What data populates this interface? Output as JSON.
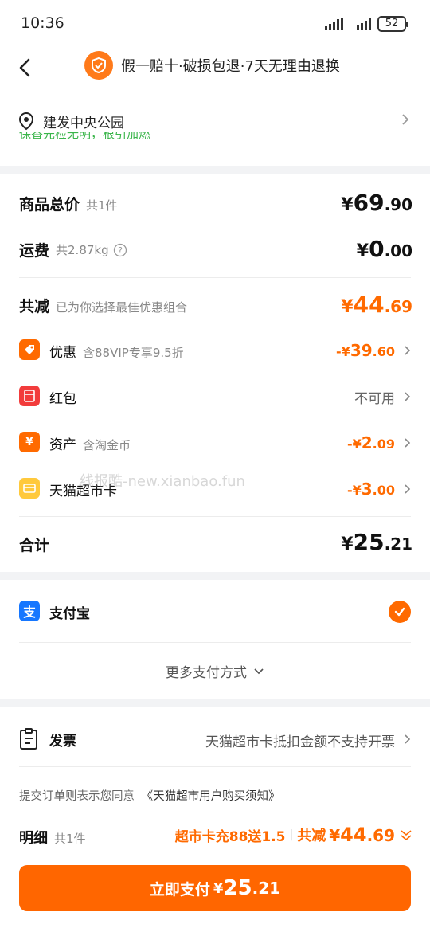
{
  "status_bar": {
    "time": "10:36",
    "battery": "52"
  },
  "header": {
    "guarantee_text": "假一赔十·破损包退·7天无理由退换"
  },
  "address": {
    "name": "建发中央公园",
    "cut_notice": "保香先检无明，根引加燃"
  },
  "price": {
    "goods_total": {
      "label": "商品总价",
      "sub": "共1件",
      "currency": "¥",
      "int": "69",
      "dec": ".90"
    },
    "shipping": {
      "label": "运费",
      "sub": "共2.87kg",
      "currency": "¥",
      "int": "0",
      "dec": ".00"
    },
    "discount_total": {
      "label": "共减",
      "sub": "已为你选择最佳优惠组合",
      "currency": "¥",
      "int": "44",
      "dec": ".69"
    },
    "items": [
      {
        "label": "优惠",
        "sub": "含88VIP专享9.5折",
        "value_prefix": "-¥",
        "int": "39",
        "dec": ".60",
        "icon": "tag-icon"
      },
      {
        "label": "红包",
        "sub": "",
        "value_text": "不可用",
        "icon": "red-packet-icon"
      },
      {
        "label": "资产",
        "sub": "含淘金币",
        "value_prefix": "-¥",
        "int": "2",
        "dec": ".09",
        "icon": "yen-asset-icon"
      },
      {
        "label": "天猫超市卡",
        "sub": "",
        "value_prefix": "-¥",
        "int": "3",
        "dec": ".00",
        "icon": "card-icon"
      }
    ],
    "total": {
      "label": "合计",
      "currency": "¥",
      "int": "25",
      "dec": ".21"
    }
  },
  "watermark": "线报酷-new.xianbao.fun",
  "payment": {
    "method": "支付宝",
    "more": "更多支付方式"
  },
  "invoice": {
    "label": "发票",
    "value": "天猫超市卡抵扣金额不支持开票"
  },
  "agreement": {
    "prefix": "提交订单则表示您同意",
    "link": "《天猫超市用户购买须知》"
  },
  "detail": {
    "label": "明细",
    "sub": "共1件",
    "promo": "超市卡充88送1.5",
    "sep": "|",
    "discount_label": "共减",
    "currency": "¥",
    "int": "44",
    "dec": ".69"
  },
  "pay_button": {
    "label": "立即支付",
    "currency": "¥",
    "int": "25",
    "dec": ".21"
  },
  "colors": {
    "accent": "#ff6a00",
    "alipay": "#1677ff",
    "green_notice": "#3ab54a"
  }
}
